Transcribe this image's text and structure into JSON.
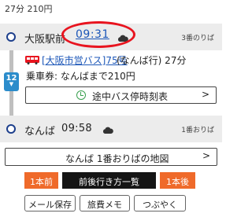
{
  "summary": {
    "text": "27分 210円"
  },
  "departure": {
    "station": "大阪駅前",
    "time": "09:31",
    "platform": "3番のりば",
    "weather_icon": "cloud-icon"
  },
  "segment": {
    "line_badge": "12",
    "bus_name": "[大阪市営バス]75号",
    "bus_detail": "(なんば行) 27分",
    "fare": "乗車券: なんばまで210円",
    "stops_button": "途中バス停時刻表"
  },
  "arrival": {
    "station": "なんば",
    "time": "09:58",
    "platform": "1番おりば",
    "weather_icon": "cloud-icon"
  },
  "map_button": "なんば 1番おりばの地図",
  "navigation": {
    "prev": "1本前",
    "list": "前後行き方一覧",
    "next": "1本後"
  },
  "actions": {
    "memo": "メール保存",
    "trip": "旅費メモ",
    "tweet": "つぶやく"
  },
  "colors": {
    "accent_orange": "#ef6a2a",
    "link_blue": "#1b56b8",
    "line_blue": "#2b8ccb",
    "annotation_red": "#e8141f"
  }
}
